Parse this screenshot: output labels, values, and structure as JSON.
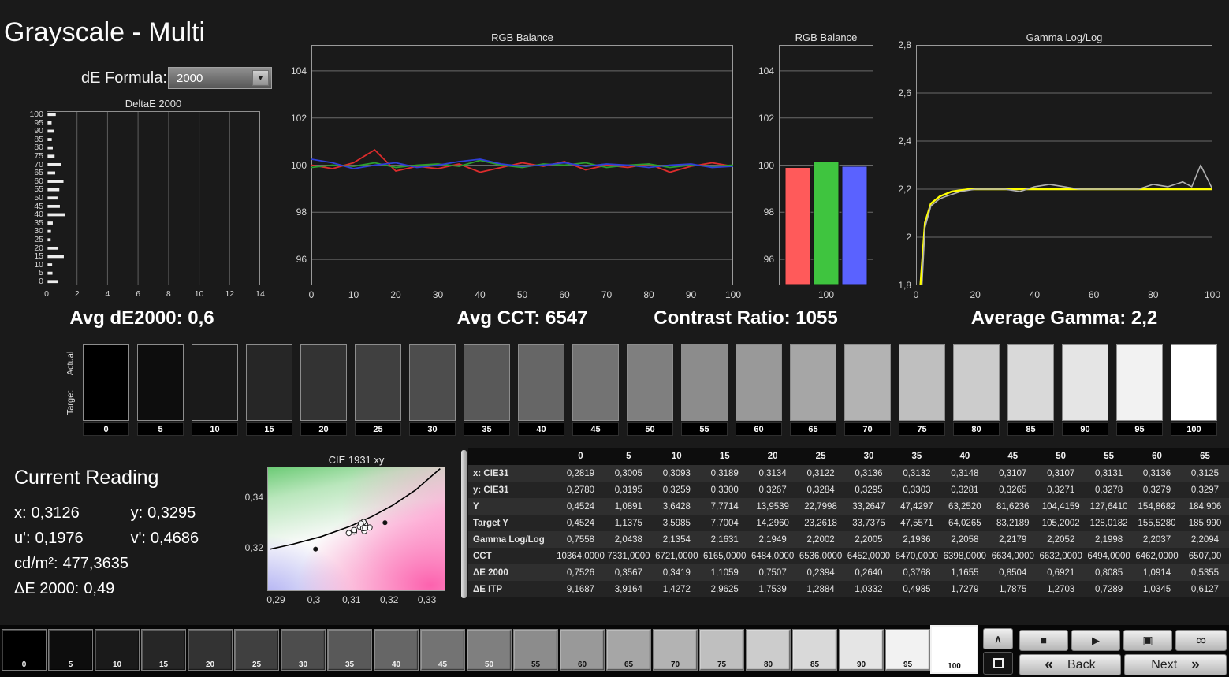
{
  "window": {
    "title": "Grayscale - Multi",
    "de_formula_label": "dE Formula:",
    "de_formula_value": "2000",
    "dropdown_arrow_icon": "▼"
  },
  "summary_stats": {
    "avg_de": "Avg dE2000: 0,6",
    "avg_cct": "Avg CCT: 6547",
    "contrast_ratio": "Contrast Ratio: 1055",
    "avg_gamma": "Average Gamma: 2,2"
  },
  "charts": {
    "delta_e": {
      "title": "DeltaE 2000",
      "type": "bar",
      "x_ticks": [
        0,
        2,
        4,
        6,
        8,
        10,
        12,
        14
      ],
      "x_max": 14,
      "y_tick_levels": [
        100,
        95,
        90,
        85,
        80,
        75,
        70,
        65,
        60,
        55,
        50,
        45,
        40,
        35,
        30,
        25,
        20,
        15,
        10,
        5,
        0
      ],
      "levels": [
        0,
        5,
        10,
        15,
        20,
        25,
        30,
        35,
        40,
        45,
        50,
        55,
        60,
        65,
        70,
        75,
        80,
        85,
        90,
        95,
        100
      ],
      "values": [
        0.75,
        0.36,
        0.34,
        1.11,
        0.75,
        0.24,
        0.26,
        0.38,
        1.17,
        0.85,
        0.69,
        0.81,
        1.09,
        0.54,
        0.92,
        0.5,
        0.38,
        0.31,
        0.45,
        0.3,
        0.58
      ]
    },
    "rgb_balance_line": {
      "title": "RGB Balance",
      "type": "line",
      "y_min": 94.9,
      "y_max": 105.1,
      "y_ticks": [
        104,
        102,
        100,
        98,
        96
      ],
      "x_ticks": [
        0,
        10,
        20,
        30,
        40,
        50,
        60,
        70,
        80,
        90,
        100
      ],
      "x": [
        0,
        5,
        10,
        15,
        20,
        25,
        30,
        35,
        40,
        45,
        50,
        55,
        60,
        65,
        70,
        75,
        80,
        85,
        90,
        95,
        100
      ],
      "series": [
        {
          "name": "Red",
          "color": "#dd2c2c",
          "values": [
            100.0,
            99.85,
            100.1,
            100.65,
            99.75,
            99.95,
            99.85,
            100.05,
            99.7,
            99.9,
            100.1,
            99.95,
            100.15,
            99.8,
            100.0,
            99.9,
            100.05,
            99.7,
            99.95,
            100.1,
            99.95
          ]
        },
        {
          "name": "Green",
          "color": "#2d9f2d",
          "values": [
            99.9,
            100.0,
            99.95,
            100.1,
            99.9,
            100.0,
            100.05,
            99.95,
            100.2,
            100.0,
            99.9,
            100.05,
            100.0,
            100.1,
            99.9,
            100.0,
            100.05,
            99.9,
            100.0,
            99.95,
            100.0
          ]
        },
        {
          "name": "Blue",
          "color": "#2f3fd6",
          "values": [
            100.25,
            100.1,
            99.85,
            100.0,
            100.1,
            99.9,
            100.0,
            100.15,
            100.25,
            100.05,
            99.95,
            100.0,
            100.1,
            99.95,
            100.05,
            100.0,
            99.9,
            100.0,
            100.05,
            99.9,
            99.95
          ]
        }
      ]
    },
    "rgb_balance_bars": {
      "title": "RGB Balance",
      "type": "bar",
      "y_min": 94.9,
      "y_max": 105.1,
      "y_ticks": [
        104,
        102,
        100,
        98,
        96
      ],
      "x_label": "100",
      "bars": [
        {
          "name": "Red",
          "color": "#ff5a5a",
          "value": 99.9
        },
        {
          "name": "Green",
          "color": "#3fc43f",
          "value": 100.15
        },
        {
          "name": "Blue",
          "color": "#5a62ff",
          "value": 99.95
        }
      ]
    },
    "gamma": {
      "title": "Gamma Log/Log",
      "type": "line",
      "y_min": 1.8,
      "y_max": 2.8,
      "y_ticks": [
        [
          "2,8",
          2.8
        ],
        [
          "2,6",
          2.6
        ],
        [
          "2,4",
          2.4
        ],
        [
          "2,2",
          2.2
        ],
        [
          "2",
          2.0
        ],
        [
          "1,8",
          1.8
        ]
      ],
      "x_ticks": [
        0,
        20,
        40,
        60,
        80,
        100
      ],
      "target": {
        "name": "Target",
        "color": "#ffff00",
        "points": [
          [
            1.5,
            1.8
          ],
          [
            3,
            2.06
          ],
          [
            5,
            2.14
          ],
          [
            8,
            2.17
          ],
          [
            12,
            2.19
          ],
          [
            18,
            2.2
          ],
          [
            100,
            2.2
          ]
        ]
      },
      "measured": {
        "name": "Measured",
        "color": "#b0b0b0",
        "points": [
          [
            2,
            1.8
          ],
          [
            3,
            2.04
          ],
          [
            5,
            2.13
          ],
          [
            8,
            2.16
          ],
          [
            10,
            2.17
          ],
          [
            15,
            2.19
          ],
          [
            20,
            2.2
          ],
          [
            25,
            2.2
          ],
          [
            30,
            2.2
          ],
          [
            35,
            2.19
          ],
          [
            40,
            2.21
          ],
          [
            45,
            2.22
          ],
          [
            50,
            2.21
          ],
          [
            55,
            2.2
          ],
          [
            60,
            2.2
          ],
          [
            65,
            2.2
          ],
          [
            70,
            2.2
          ],
          [
            75,
            2.2
          ],
          [
            80,
            2.22
          ],
          [
            85,
            2.21
          ],
          [
            90,
            2.23
          ],
          [
            93,
            2.21
          ],
          [
            96,
            2.3
          ],
          [
            100,
            2.2
          ]
        ]
      }
    },
    "cie": {
      "title": "CIE 1931 xy",
      "type": "scatter",
      "x_ticks": [
        [
          "0,29",
          0.29
        ],
        [
          "0,3",
          0.3
        ],
        [
          "0,31",
          0.31
        ],
        [
          "0,32",
          0.32
        ],
        [
          "0,33",
          0.33
        ]
      ],
      "y_ticks": [
        [
          "0,34",
          0.34
        ],
        [
          "0,32",
          0.32
        ]
      ],
      "x_range": [
        0.2879,
        0.3351
      ],
      "y_range": [
        0.3025,
        0.352
      ],
      "locus": [
        [
          0.3335,
          0.3515
        ],
        [
          0.327,
          0.343
        ],
        [
          0.321,
          0.337
        ],
        [
          0.3155,
          0.3325
        ],
        [
          0.3095,
          0.3285
        ],
        [
          0.302,
          0.3245
        ],
        [
          0.2945,
          0.3215
        ],
        [
          0.2885,
          0.3195
        ]
      ],
      "points": [
        {
          "x": 0.3005,
          "y": 0.3195,
          "filled": true
        },
        {
          "x": 0.3093,
          "y": 0.3259,
          "filled": false
        },
        {
          "x": 0.3189,
          "y": 0.33,
          "filled": true
        },
        {
          "x": 0.3134,
          "y": 0.3267,
          "filled": false
        },
        {
          "x": 0.3122,
          "y": 0.3284,
          "filled": false
        },
        {
          "x": 0.3136,
          "y": 0.3295,
          "filled": false
        },
        {
          "x": 0.3132,
          "y": 0.3303,
          "filled": false
        },
        {
          "x": 0.3148,
          "y": 0.3281,
          "filled": false
        },
        {
          "x": 0.3107,
          "y": 0.3265,
          "filled": false
        },
        {
          "x": 0.3107,
          "y": 0.3271,
          "filled": false
        },
        {
          "x": 0.3131,
          "y": 0.3278,
          "filled": false
        },
        {
          "x": 0.3136,
          "y": 0.3279,
          "filled": false
        },
        {
          "x": 0.3125,
          "y": 0.3297,
          "filled": false
        }
      ]
    }
  },
  "grayscale_strip": {
    "actual_label": "Actual",
    "target_label": "Target",
    "levels": [
      0,
      5,
      10,
      15,
      20,
      25,
      30,
      35,
      40,
      45,
      50,
      55,
      60,
      65,
      70,
      75,
      80,
      85,
      90,
      95,
      100
    ]
  },
  "current_reading": {
    "title": "Current Reading",
    "x_label": "x:",
    "x_value": "0,3126",
    "y_label": "y:",
    "y_value": "0,3295",
    "u_label": "u':",
    "u_value": "0,1976",
    "v_label": "v':",
    "v_value": "0,4686",
    "luminance_label": "cd/m²:",
    "luminance_value": "477,3635",
    "de_label": "ΔE 2000:",
    "de_value": "0,49"
  },
  "table": {
    "columns": [
      "0",
      "5",
      "10",
      "15",
      "20",
      "25",
      "30",
      "35",
      "40",
      "45",
      "50",
      "55",
      "60",
      "65"
    ],
    "rows": [
      {
        "label": "x: CIE31",
        "values": [
          "0,2819",
          "0,3005",
          "0,3093",
          "0,3189",
          "0,3134",
          "0,3122",
          "0,3136",
          "0,3132",
          "0,3148",
          "0,3107",
          "0,3107",
          "0,3131",
          "0,3136",
          "0,3125"
        ]
      },
      {
        "label": "y: CIE31",
        "values": [
          "0,2780",
          "0,3195",
          "0,3259",
          "0,3300",
          "0,3267",
          "0,3284",
          "0,3295",
          "0,3303",
          "0,3281",
          "0,3265",
          "0,3271",
          "0,3278",
          "0,3279",
          "0,3297"
        ]
      },
      {
        "label": "Y",
        "values": [
          "0,4524",
          "1,0891",
          "3,6428",
          "7,7714",
          "13,9539",
          "22,7998",
          "33,2647",
          "47,4297",
          "63,2520",
          "81,6236",
          "104,4159",
          "127,6410",
          "154,8682",
          "184,906"
        ]
      },
      {
        "label": "Target Y",
        "values": [
          "0,4524",
          "1,1375",
          "3,5985",
          "7,7004",
          "14,2960",
          "23,2618",
          "33,7375",
          "47,5571",
          "64,0265",
          "83,2189",
          "105,2002",
          "128,0182",
          "155,5280",
          "185,990"
        ]
      },
      {
        "label": "Gamma Log/Log",
        "values": [
          "0,7558",
          "2,0438",
          "2,1354",
          "2,1631",
          "2,1949",
          "2,2002",
          "2,2005",
          "2,1936",
          "2,2058",
          "2,2179",
          "2,2052",
          "2,1998",
          "2,2037",
          "2,2094"
        ]
      },
      {
        "label": "CCT",
        "values": [
          "10364,0000",
          "7331,0000",
          "6721,0000",
          "6165,0000",
          "6484,0000",
          "6536,0000",
          "6452,0000",
          "6470,0000",
          "6398,0000",
          "6634,0000",
          "6632,0000",
          "6494,0000",
          "6462,0000",
          "6507,00"
        ]
      },
      {
        "label": "ΔE 2000",
        "values": [
          "0,7526",
          "0,3567",
          "0,3419",
          "1,1059",
          "0,7507",
          "0,2394",
          "0,2640",
          "0,3768",
          "1,1655",
          "0,8504",
          "0,6921",
          "0,8085",
          "1,0914",
          "0,5355"
        ]
      },
      {
        "label": "ΔE ITP",
        "values": [
          "9,1687",
          "3,9164",
          "1,4272",
          "2,9625",
          "1,7539",
          "1,2884",
          "1,0332",
          "0,4985",
          "1,7279",
          "1,7875",
          "1,2703",
          "0,7289",
          "1,0345",
          "0,6127"
        ]
      }
    ]
  },
  "toolbar": {
    "levels": [
      0,
      5,
      10,
      15,
      20,
      25,
      30,
      35,
      40,
      45,
      50,
      55,
      60,
      65,
      70,
      75,
      80,
      85,
      90,
      95,
      100
    ],
    "selected_level": 100,
    "icons": {
      "up": "∧",
      "stop": "■",
      "play": "▶",
      "single": "▣",
      "continuous": "∞",
      "back_chevron": "«",
      "next_chevron": "»"
    },
    "back_label": "Back",
    "next_label": "Next"
  }
}
